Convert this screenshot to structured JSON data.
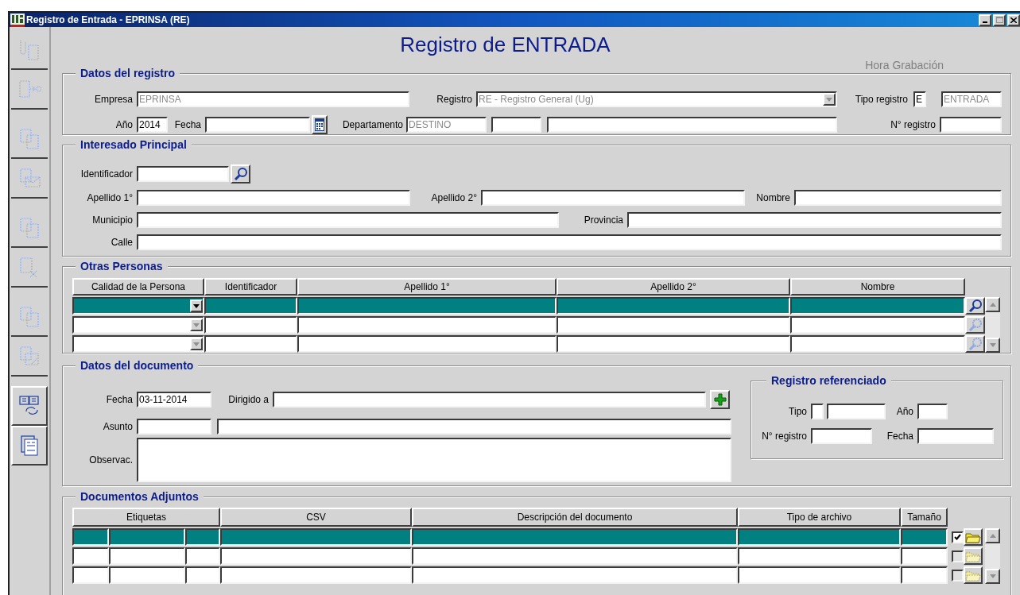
{
  "window": {
    "title": "Registro de Entrada - EPRINSA (RE)"
  },
  "toolbar": [
    {
      "kind": "clip",
      "disabled": true
    },
    {
      "kind": "export",
      "disabled": true
    },
    {
      "kind": "copy",
      "disabled": true
    },
    {
      "kind": "mail",
      "disabled": true
    },
    {
      "kind": "copy",
      "disabled": true
    },
    {
      "kind": "delete",
      "disabled": true
    },
    {
      "kind": "copy",
      "disabled": true
    },
    {
      "kind": "edit",
      "disabled": true
    },
    {
      "kind": "refresh",
      "disabled": false
    },
    {
      "kind": "form",
      "disabled": false
    }
  ],
  "heading": "Registro de ENTRADA",
  "record_time_label": "Hora Grabación",
  "registro": {
    "title": "Datos del registro",
    "lines": [
      {
        "items": [
          {
            "kind": "label",
            "text": "Empresa"
          },
          {
            "kind": "field",
            "value": "EPRINSA",
            "readonly": true
          },
          {
            "kind": "label",
            "text": "Registro"
          },
          {
            "kind": "combo",
            "value": "RE - Registro General (Ug)",
            "readonly": true
          },
          {
            "kind": "label",
            "text": "Tipo registro"
          },
          {
            "kind": "field",
            "value": "E",
            "readonly": false
          },
          {
            "kind": "field",
            "value": "ENTRADA",
            "readonly": true
          }
        ]
      },
      {
        "items": [
          {
            "kind": "label",
            "text": "Año"
          },
          {
            "kind": "field",
            "value": "2014",
            "readonly": false
          },
          {
            "kind": "label",
            "text": "Fecha"
          },
          {
            "kind": "field"
          },
          {
            "kind": "calendar"
          },
          {
            "kind": "label",
            "text": "Departamento"
          },
          {
            "kind": "field",
            "value": "DESTINO",
            "readonly": true
          },
          {
            "kind": "field"
          },
          {
            "kind": "field"
          },
          {
            "kind": "label",
            "text": "N° registro"
          },
          {
            "kind": "field"
          }
        ]
      }
    ]
  },
  "interesado": {
    "title": "Interesado Principal",
    "lines": [
      {
        "items": [
          {
            "kind": "label",
            "text": "Identificador"
          },
          {
            "kind": "field"
          },
          {
            "kind": "search"
          }
        ]
      },
      {
        "items": [
          {
            "kind": "label",
            "text": "Apellido 1°"
          },
          {
            "kind": "field"
          },
          {
            "kind": "label",
            "text": "Apellido 2°"
          },
          {
            "kind": "field"
          },
          {
            "kind": "label",
            "text": "Nombre"
          },
          {
            "kind": "field"
          }
        ]
      },
      {
        "items": [
          {
            "kind": "label",
            "text": "Municipio"
          },
          {
            "kind": "field"
          },
          {
            "kind": "label",
            "text": "Provincia"
          },
          {
            "kind": "field"
          }
        ]
      },
      {
        "items": [
          {
            "kind": "label",
            "text": "Calle"
          },
          {
            "kind": "field"
          }
        ]
      }
    ]
  },
  "otras_personas": {
    "title": "Otras Personas",
    "columns": [
      "Calidad de la Persona",
      "Identificador",
      "Apellido 1°",
      "Apellido 2°",
      "Nombre"
    ],
    "rows": [
      {
        "selected": true
      },
      {
        "selected": false
      },
      {
        "selected": false
      }
    ]
  },
  "documento": {
    "title": "Datos del documento",
    "lines": [
      {
        "items": [
          {
            "kind": "label",
            "text": "Fecha"
          },
          {
            "kind": "field",
            "value": "03-11-2014",
            "readonly": false
          },
          {
            "kind": "label",
            "text": "Dirigido a"
          },
          {
            "kind": "field"
          },
          {
            "kind": "add"
          }
        ]
      },
      {
        "items": [
          {
            "kind": "label",
            "text": "Asunto"
          },
          {
            "kind": "field"
          },
          {
            "kind": "field"
          }
        ]
      },
      {
        "items": [
          {
            "kind": "label",
            "text": "Observac."
          },
          {
            "kind": "memo"
          }
        ]
      }
    ],
    "referenced": {
      "title": "Registro referenciado",
      "lines": [
        {
          "items": [
            {
              "kind": "label",
              "text": "Tipo"
            },
            {
              "kind": "field"
            },
            {
              "kind": "field"
            },
            {
              "kind": "label",
              "text": "Año"
            },
            {
              "kind": "field"
            }
          ]
        },
        {
          "items": [
            {
              "kind": "label",
              "text": "N° registro"
            },
            {
              "kind": "field"
            },
            {
              "kind": "label",
              "text": "Fecha"
            },
            {
              "kind": "field"
            }
          ]
        }
      ]
    }
  },
  "adjuntos": {
    "title": "Documentos Adjuntos",
    "columns": [
      "Etiquetas",
      "CSV",
      "Descripción del documento",
      "Tipo de archivo",
      "Tamaño"
    ],
    "rows": [
      {
        "selected": true,
        "checked": true
      },
      {
        "selected": false,
        "checked": false
      },
      {
        "selected": false,
        "checked": false
      }
    ]
  }
}
